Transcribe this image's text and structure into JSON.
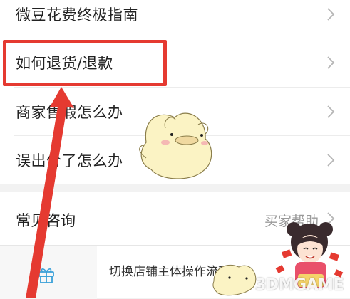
{
  "menu": {
    "items": [
      {
        "label": "微豆花费终极指南"
      },
      {
        "label": "如何退货/退款"
      },
      {
        "label": "商家售假怎么办"
      },
      {
        "label": "误出价了怎么办"
      }
    ]
  },
  "consult": {
    "label": "常见咨询",
    "helper_link": "买家帮助"
  },
  "bottom": {
    "shop_flow_label": "切换店铺主体操作流程"
  },
  "icons": {
    "chevron": "chevron-right-icon",
    "gift": "gift-icon"
  },
  "colors": {
    "highlight": "#e53a31",
    "background": "#f2f2f2"
  },
  "watermark": "3DMGAME"
}
